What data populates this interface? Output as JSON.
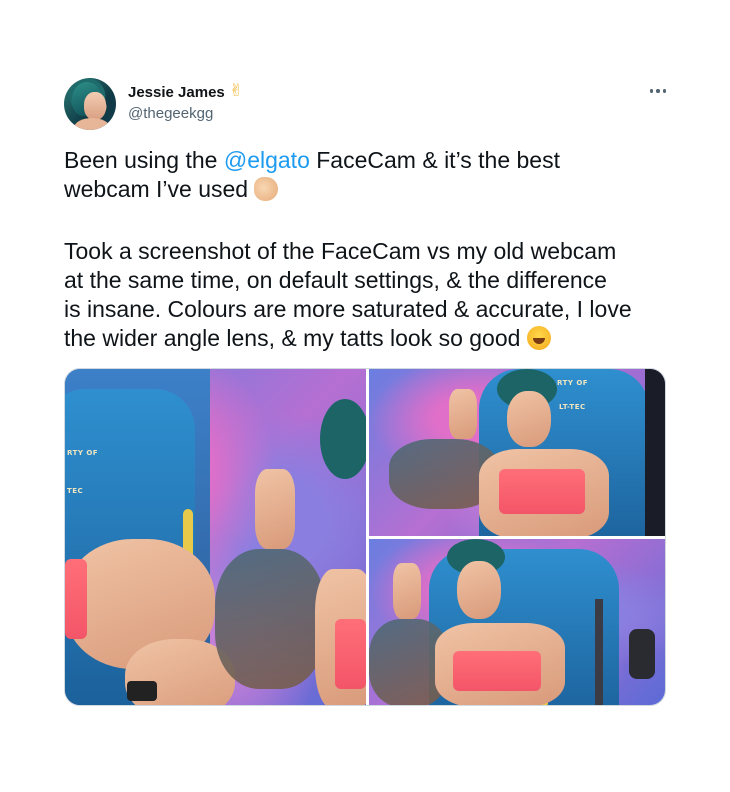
{
  "author": {
    "display_name": "Jessie James",
    "name_emoji": "✌",
    "handle": "@thegeekgg",
    "avatar_icon": "avatar-photo"
  },
  "more_icon": "more-options-icon",
  "tweet": {
    "line1_before": "Been using the ",
    "mention": "@elgato",
    "line1_after": " FaceCam & it’s the best",
    "line2": "webcam I’ve used ",
    "para2_l1": "Took a screenshot of the FaceCam vs my old webcam",
    "para2_l2": "at the same time, on default settings, & the difference",
    "para2_l3": "is insane. Colours are more saturated & accurate, I love",
    "para2_l4": "the wider angle lens, & my tatts look so good "
  },
  "media": {
    "count": 3,
    "chair_logo_left_1": "RTY OF",
    "chair_logo_left_2": "TEC",
    "chair_logo_tr_1": "RTY OF",
    "chair_logo_tr_2": "LT-TEC"
  },
  "colors": {
    "mention": "#1d9bf0",
    "text": "#0f1419",
    "secondary": "#536471"
  }
}
